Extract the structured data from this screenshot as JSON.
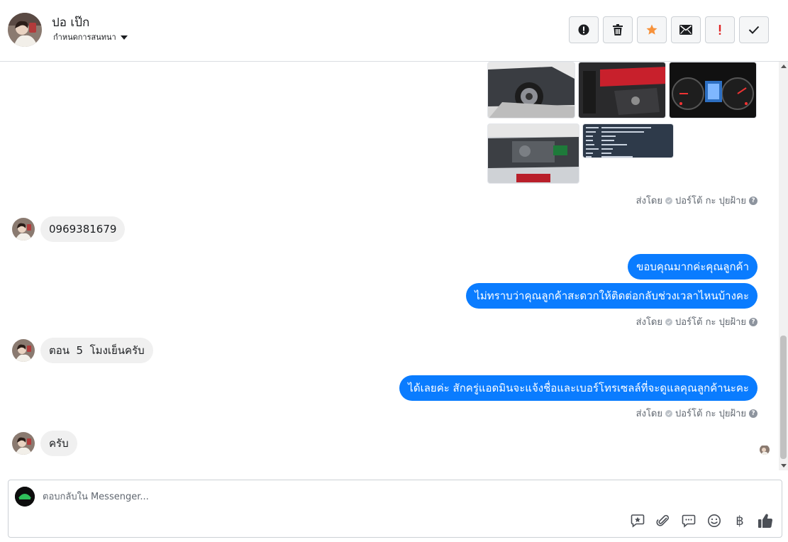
{
  "header": {
    "contact_name": "ปอ เป๊ก",
    "assign_label": "กำหนดการสนทนา",
    "toolbar": [
      {
        "name": "spam-button",
        "icon": "alert-circle-icon"
      },
      {
        "name": "delete-button",
        "icon": "trash-icon"
      },
      {
        "name": "star-button",
        "icon": "star-icon",
        "color": "#f7923b"
      },
      {
        "name": "mark-unread-button",
        "icon": "envelope-icon"
      },
      {
        "name": "follow-up-button",
        "icon": "exclamation-icon",
        "color": "#e02424"
      },
      {
        "name": "mark-done-button",
        "icon": "checkmark-icon"
      }
    ]
  },
  "thread": {
    "sent_by_label": "ส่งโดย",
    "sender_name": "ปอร์โต้ กะ ปุยฝ้าย",
    "messages": [
      {
        "dir": "in",
        "text": "0969381679"
      },
      {
        "dir": "out",
        "text": "ขอบคุณมากค่ะคุณลูกค้า"
      },
      {
        "dir": "out",
        "text": "ไม่ทราบว่าคุณลูกค้าสะดวกให้ติดต่อกลับช่วงเวลาไหนบ้างคะ"
      },
      {
        "dir": "in",
        "text": "ตอน  5  โมงเย็นครับ"
      },
      {
        "dir": "out",
        "text": "ได้เลยค่ะ สักครู่แอดมินจะแจ้งชื่อและเบอร์โทรเซลล์ที่จะดูแลคุณลูกค้านะคะ"
      },
      {
        "dir": "in",
        "text": "ครับ"
      }
    ],
    "colors": {
      "outgoing_bubble": "#0a7cff",
      "incoming_bubble": "#f0f0f0"
    }
  },
  "composer": {
    "placeholder": "ตอบกลับใน Messenger...",
    "currency_symbol": "฿",
    "tools": [
      "saved-reply-icon",
      "paperclip-icon",
      "chat-bubble-icon",
      "smiley-icon",
      "baht-icon",
      "thumbs-up-icon"
    ]
  }
}
